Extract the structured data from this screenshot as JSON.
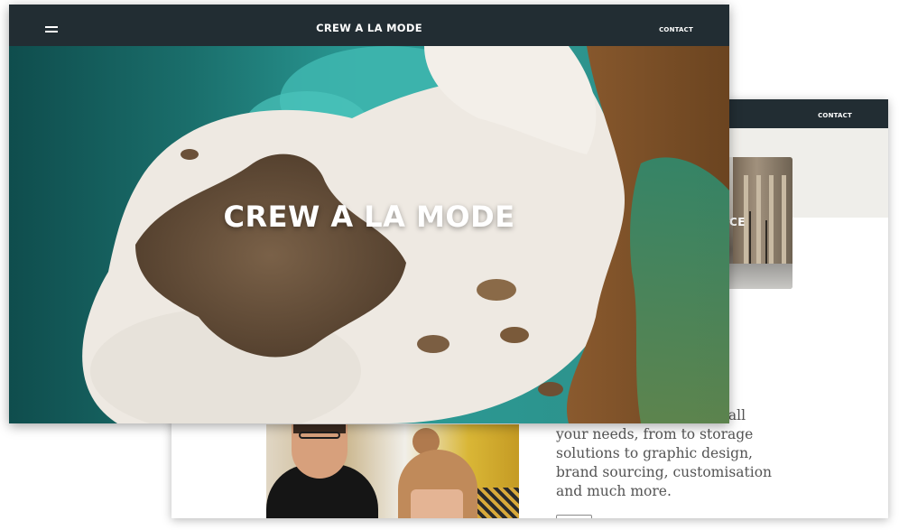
{
  "back_page": {
    "nav": {
      "contact": "CONTACT"
    },
    "banner_fragment": "CE",
    "body_lines": [
      "n all",
      "your needs, from to storage",
      "solutions to graphic design,",
      "brand sourcing, customisation",
      "and much more."
    ]
  },
  "front_page": {
    "nav": {
      "menu_icon": "hamburger-icon",
      "brand": "CREW A LA MODE",
      "contact": "CONTACT"
    },
    "hero": {
      "title": "CREW A LA MODE",
      "image": "aerial-ocean-waves-on-rocky-coast"
    }
  },
  "colors": {
    "nav_bg": "#222d33",
    "band_bg": "#efeeea",
    "text": "#545454"
  }
}
